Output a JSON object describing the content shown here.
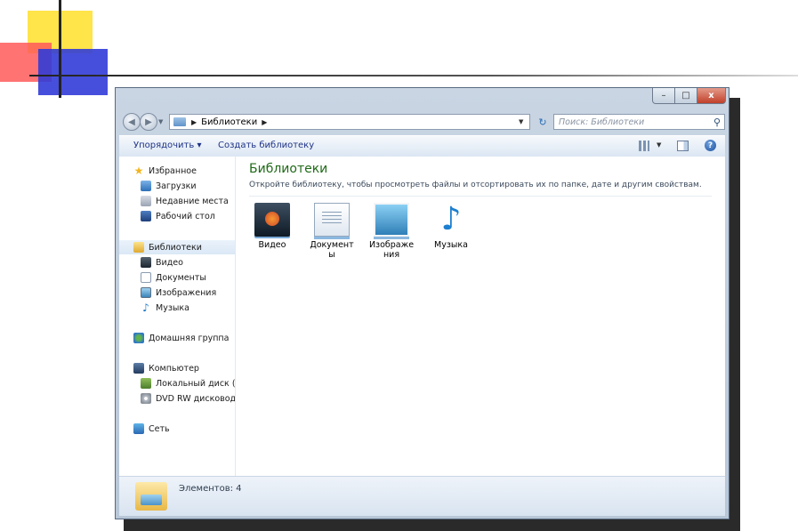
{
  "window": {
    "controls": {
      "minimize": "–",
      "maximize": "□",
      "close": "x"
    }
  },
  "navbar": {
    "back_icon": "arrow-left-icon",
    "forward_icon": "arrow-right-icon",
    "breadcrumb": {
      "current": "Библиотеки"
    },
    "search": {
      "placeholder": "Поиск: Библиотеки"
    }
  },
  "toolbar": {
    "organize_label": "Упорядочить ▾",
    "create_label": "Создать библиотеку"
  },
  "sidebar": {
    "favorites": {
      "label": "Избранное",
      "items": [
        {
          "label": "Загрузки"
        },
        {
          "label": "Недавние места"
        },
        {
          "label": "Рабочий стол"
        }
      ]
    },
    "libraries": {
      "label": "Библиотеки",
      "items": [
        {
          "label": "Видео"
        },
        {
          "label": "Документы"
        },
        {
          "label": "Изображения"
        },
        {
          "label": "Музыка"
        }
      ]
    },
    "homegroup": {
      "label": "Домашняя группа"
    },
    "computer": {
      "label": "Компьютер",
      "items": [
        {
          "label": "Локальный диск (C"
        },
        {
          "label": "DVD RW дисковод ("
        }
      ]
    },
    "network": {
      "label": "Сеть"
    }
  },
  "content": {
    "title": "Библиотеки",
    "subtitle": "Откройте библиотеку, чтобы просмотреть файлы и отсортировать их по папке, дате и другим свойствам.",
    "libraries": [
      {
        "label": "Видео",
        "icon": "video-library-icon"
      },
      {
        "label": "Документ ы",
        "icon": "documents-library-icon"
      },
      {
        "label": "Изображе ния",
        "icon": "pictures-library-icon"
      },
      {
        "label": "Музыка",
        "icon": "music-library-icon"
      }
    ]
  },
  "statusbar": {
    "text": "Элементов: 4"
  },
  "colors": {
    "title_green": "#1f6a17",
    "toolbar_text": "#1e3287",
    "close_red": "#c1402a"
  }
}
